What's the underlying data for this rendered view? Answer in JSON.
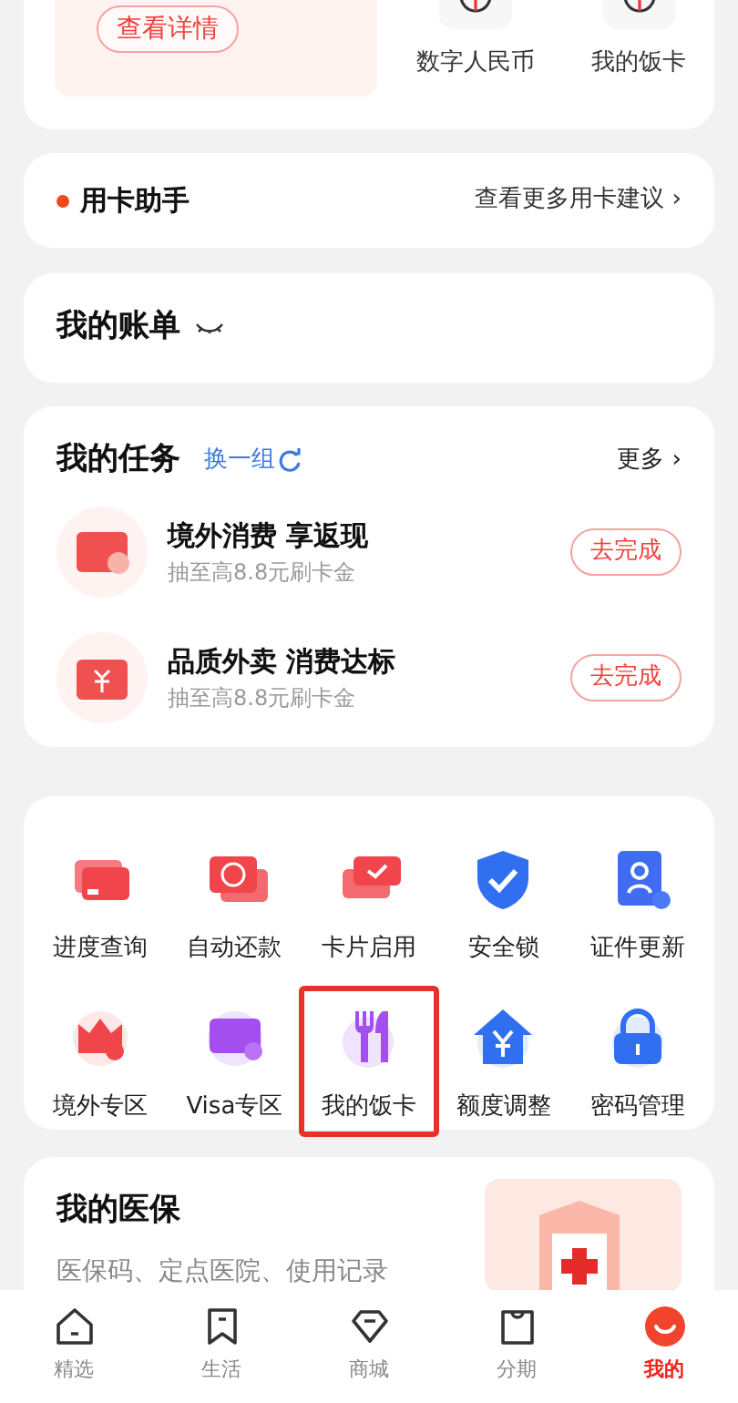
{
  "top_card": {
    "detail_button": "查看详情",
    "shortcuts": [
      {
        "label": "数字人民币"
      },
      {
        "label": "我的饭卡"
      }
    ]
  },
  "card_assistant": {
    "title": "用卡助手",
    "link": "查看更多用卡建议",
    "chevron": "›"
  },
  "bill": {
    "title": "我的账单"
  },
  "tasks": {
    "title": "我的任务",
    "refresh": "换一组",
    "more": "更多",
    "chevron": "›",
    "items": [
      {
        "title": "境外消费 享返现",
        "subtitle": "抽至高8.8元刷卡金",
        "button": "去完成"
      },
      {
        "title": "品质外卖 消费达标",
        "subtitle": "抽至高8.8元刷卡金",
        "button": "去完成"
      }
    ]
  },
  "services": [
    {
      "label": "进度查询",
      "selected": false
    },
    {
      "label": "自动还款",
      "selected": false
    },
    {
      "label": "卡片启用",
      "selected": false
    },
    {
      "label": "安全锁",
      "selected": false
    },
    {
      "label": "证件更新",
      "selected": false
    },
    {
      "label": "境外专区",
      "selected": false
    },
    {
      "label": "Visa专区",
      "selected": false
    },
    {
      "label": "我的饭卡",
      "selected": true
    },
    {
      "label": "额度调整",
      "selected": false
    },
    {
      "label": "密码管理",
      "selected": false
    }
  ],
  "medical": {
    "title": "我的医保",
    "subtitle": "医保码、定点医院、使用记录"
  },
  "tab_bar": [
    {
      "label": "精选",
      "selected": false
    },
    {
      "label": "生活",
      "selected": false
    },
    {
      "label": "商城",
      "selected": false
    },
    {
      "label": "分期",
      "selected": false
    },
    {
      "label": "我的",
      "selected": true
    }
  ]
}
